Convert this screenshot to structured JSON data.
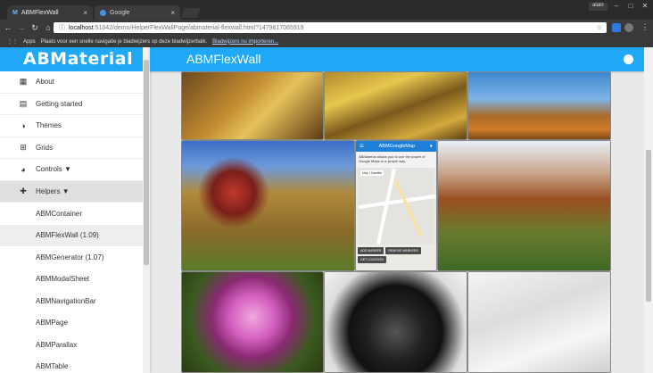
{
  "browser": {
    "tabs": [
      {
        "label": "ABMFlexWall",
        "active": true
      },
      {
        "label": "Google",
        "active": false
      }
    ],
    "user": "alain",
    "url_host": "localhost",
    "url_path": ":51042/demo/HelperFlexWallPage/abmaterial-flexwall.html?1479817065919",
    "bookmarks_apps": "Apps",
    "bookmarks_text": "Plaats voor een snelle navigatie je bladwijzers op deze bladwijzerbalk.",
    "bookmarks_link": "Bladwijzers nu importeren..."
  },
  "sidebar": {
    "logo": "ABMaterial",
    "items": [
      {
        "label": "About",
        "icon": "dashboard-icon"
      },
      {
        "label": "Getting started",
        "icon": "message-icon"
      },
      {
        "label": "Themes",
        "icon": "contrast-icon"
      },
      {
        "label": "Grids",
        "icon": "grid-icon"
      },
      {
        "label": "Controls ▼",
        "icon": "palette-icon"
      },
      {
        "label": "Helpers ▼",
        "icon": "puzzle-icon"
      }
    ],
    "subitems": [
      "ABMContainer",
      "ABMFlexWall (1.09)",
      "ABMGenerator (1.07)",
      "ABMModalSheet",
      "ABMNavigationBar",
      "ABMPage",
      "ABMParallax",
      "ABMTable"
    ]
  },
  "appbar": {
    "title": "ABMFlexWall"
  },
  "map_tile": {
    "title": "ABMGoogleMap",
    "desc": "ABMaterial allows you to use the power of Google Maps in a simple way.",
    "map_label": "Map",
    "sat_label": "Satellite",
    "buttons": [
      "ADD MARKER",
      "REMOVE MARKERS",
      "GET LOCATION"
    ]
  },
  "colors": {
    "accent": "#1ea8f5"
  }
}
